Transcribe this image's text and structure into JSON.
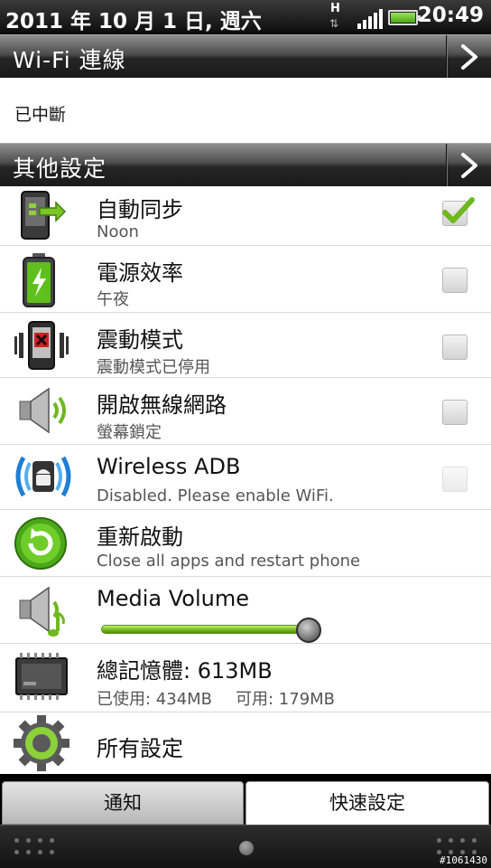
{
  "status_bar": {
    "date": "2011 年 10 月 1 日, 週六",
    "network_type": "H",
    "network_arrows": "⇅",
    "time": "20:49"
  },
  "wifi_section": {
    "title": "Wi-Fi 連線",
    "status": "已中斷"
  },
  "other_section": {
    "title": "其他設定"
  },
  "items": [
    {
      "title": "自動同步",
      "subtitle": "Noon",
      "icon": "sync-icon",
      "checked": true,
      "enabled": true
    },
    {
      "title": "電源效率",
      "subtitle": "午夜",
      "icon": "battery-icon",
      "checked": false,
      "enabled": true
    },
    {
      "title": "震動模式",
      "subtitle": "震動模式已停用",
      "icon": "vibrate-icon",
      "checked": false,
      "enabled": true
    },
    {
      "title": "開啟無線網路",
      "subtitle": "螢幕鎖定",
      "icon": "speaker-wireless-icon",
      "checked": false,
      "enabled": true
    },
    {
      "title": "Wireless ADB",
      "subtitle": "Disabled. Please enable WiFi.",
      "icon": "android-adb-icon",
      "checked": false,
      "enabled": false
    },
    {
      "title": "重新啟動",
      "subtitle": "Close all apps and restart phone",
      "icon": "restart-icon"
    },
    {
      "title": "Media Volume",
      "icon": "media-volume-icon",
      "volume_percent": 95
    },
    {
      "title": "總記憶體: 613MB",
      "used": "已使用: 434MB",
      "free": "可用: 179MB",
      "icon": "memory-chip-icon"
    },
    {
      "title": "所有設定",
      "icon": "gear-icon"
    }
  ],
  "tabs": {
    "notifications": "通知",
    "quick_settings": "快速設定",
    "active": "quick_settings"
  },
  "watermark": "#1061430",
  "colors": {
    "accent_green": "#6fb81d",
    "header_dark": "#1a1a1a",
    "list_bg": "#ffffff"
  }
}
